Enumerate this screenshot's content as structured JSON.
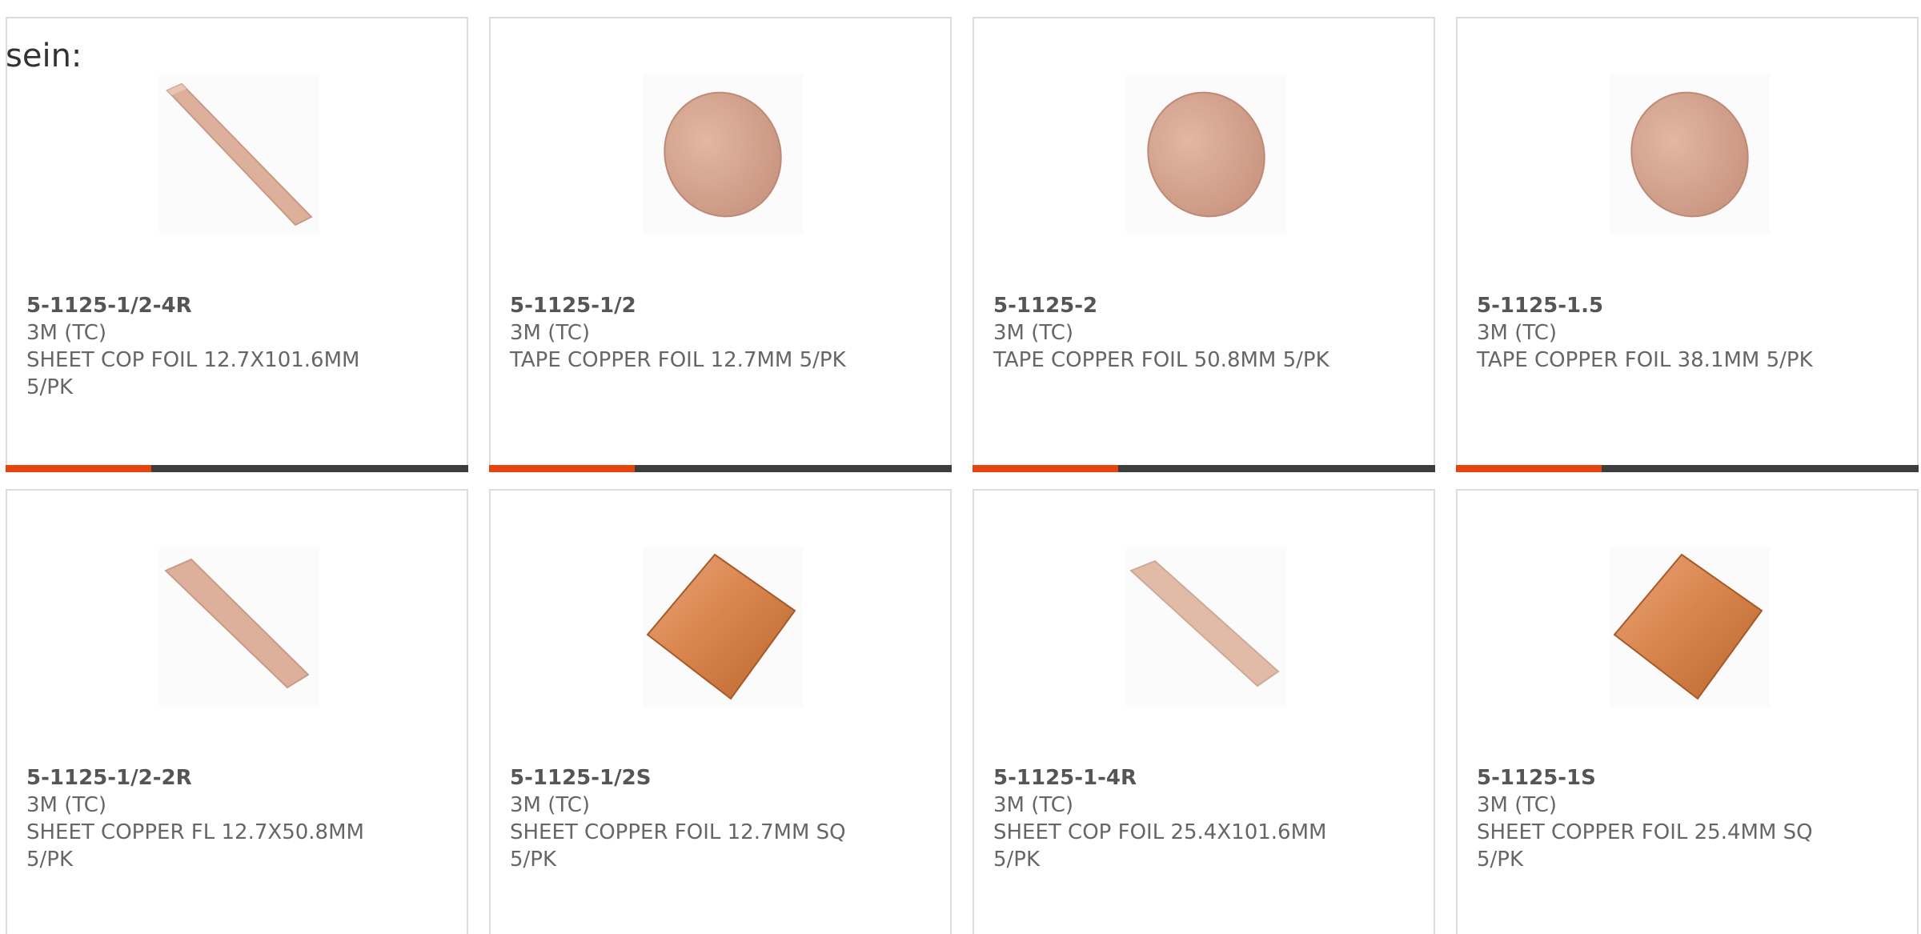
{
  "overlay_text": "sein:",
  "products": [
    {
      "part_number": "5-1125-1/2-4R",
      "manufacturer": "3M (TC)",
      "description": "SHEET COP FOIL 12.7X101.6MM 5/PK",
      "image_icon": "copper-strip-icon"
    },
    {
      "part_number": "5-1125-1/2",
      "manufacturer": "3M (TC)",
      "description": "TAPE COPPER FOIL 12.7MM 5/PK",
      "image_icon": "copper-disc-icon"
    },
    {
      "part_number": "5-1125-2",
      "manufacturer": "3M (TC)",
      "description": "TAPE COPPER FOIL 50.8MM 5/PK",
      "image_icon": "copper-disc-icon"
    },
    {
      "part_number": "5-1125-1.5",
      "manufacturer": "3M (TC)",
      "description": "TAPE COPPER FOIL 38.1MM 5/PK",
      "image_icon": "copper-disc-icon"
    },
    {
      "part_number": "5-1125-1/2-2R",
      "manufacturer": "3M (TC)",
      "description": "SHEET COPPER FL 12.7X50.8MM 5/PK",
      "image_icon": "copper-strip-icon"
    },
    {
      "part_number": "5-1125-1/2S",
      "manufacturer": "3M (TC)",
      "description": "SHEET COPPER FOIL 12.7MM SQ 5/PK",
      "image_icon": "copper-square-icon"
    },
    {
      "part_number": "5-1125-1-4R",
      "manufacturer": "3M (TC)",
      "description": "SHEET COP FOIL 25.4X101.6MM 5/PK",
      "image_icon": "copper-strip-icon"
    },
    {
      "part_number": "5-1125-1S",
      "manufacturer": "3M (TC)",
      "description": "SHEET COPPER FOIL 25.4MM SQ 5/PK",
      "image_icon": "copper-square-icon"
    }
  ],
  "colors": {
    "accent": "#e8420f",
    "bar": "#3d3d3d",
    "border": "#dcdcdc",
    "text": "#666666",
    "copper_light": "#d9a88e",
    "copper_dark": "#c9733f"
  }
}
